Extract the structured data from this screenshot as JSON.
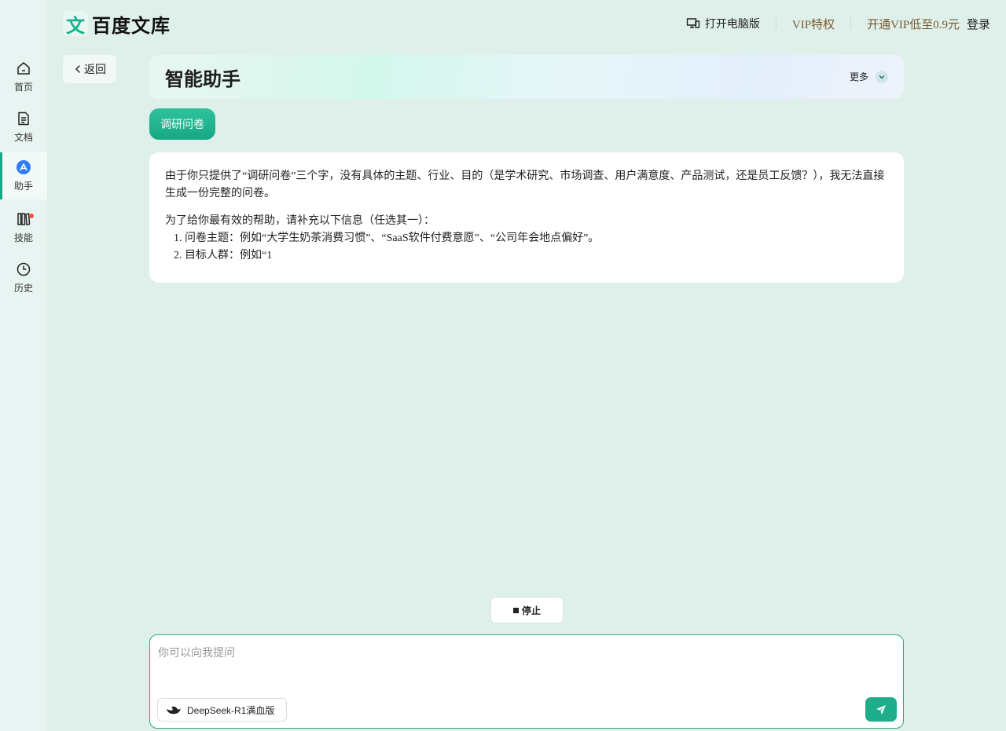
{
  "header": {
    "logo_glyph": "文",
    "logo_text": "百度文库",
    "open_pc": "打开电脑版",
    "vip_privileges": "VIP特权",
    "vip_offer": "开通VIP低至0.9元",
    "login": "登录"
  },
  "sidebar": {
    "items": [
      {
        "label": "首页",
        "icon": "home-icon"
      },
      {
        "label": "文档",
        "icon": "document-icon"
      },
      {
        "label": "助手",
        "icon": "assistant-icon"
      },
      {
        "label": "技能",
        "icon": "skills-icon"
      },
      {
        "label": "历史",
        "icon": "history-icon"
      }
    ],
    "active": "助手"
  },
  "nav": {
    "back_label": "返回"
  },
  "banner": {
    "title": "智能助手",
    "more_label": "更多"
  },
  "chat": {
    "user_prompt": "调研问卷",
    "answer_para1": "由于你只提供了“调研问卷”三个字，没有具体的主题、行业、目的（是学术研究、市场调查、用户满意度、产品测试，还是员工反馈？），我无法直接生成一份完整的问卷。",
    "answer_para2": "为了给你最有效的帮助，请补充以下信息（任选其一）：",
    "answer_list": [
      "问卷主题：例如“大学生奶茶消费习惯”、“SaaS软件付费意愿”、“公司年会地点偏好”。",
      "目标人群：例如“1"
    ]
  },
  "controls": {
    "stop_label": "停止",
    "input_placeholder": "你可以向我提问",
    "input_value": "",
    "model_label": "DeepSeek-R1满血版"
  },
  "colors": {
    "accent": "#1aa785",
    "page_bg": "#dff0eb",
    "vip_text": "#7a5a2e",
    "badge_red": "#f0523b"
  }
}
